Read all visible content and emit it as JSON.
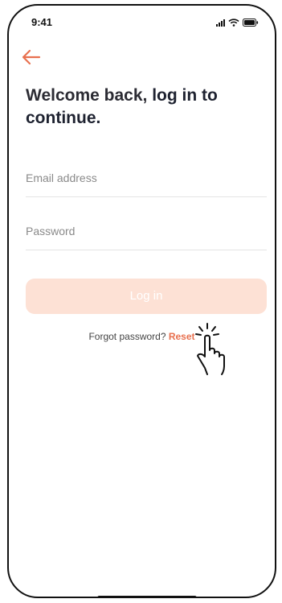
{
  "status_bar": {
    "time": "9:41",
    "icons": [
      "signal-icon",
      "wifi-icon",
      "battery-icon"
    ]
  },
  "nav": {
    "back_icon": "back-arrow-icon"
  },
  "headline": {
    "regular": "Welcome back, ",
    "bold": "log in to continue."
  },
  "form": {
    "email": {
      "value": "",
      "placeholder": "Email address"
    },
    "password": {
      "value": "",
      "placeholder": "Password"
    },
    "login_label": "Log in"
  },
  "forgot": {
    "text": "Forgot password? ",
    "link": "Reset"
  },
  "colors": {
    "accent": "#e8704f",
    "button_disabled_bg": "#fde1d5",
    "headline": "#2b2b33",
    "divider": "#e4e4e4"
  }
}
